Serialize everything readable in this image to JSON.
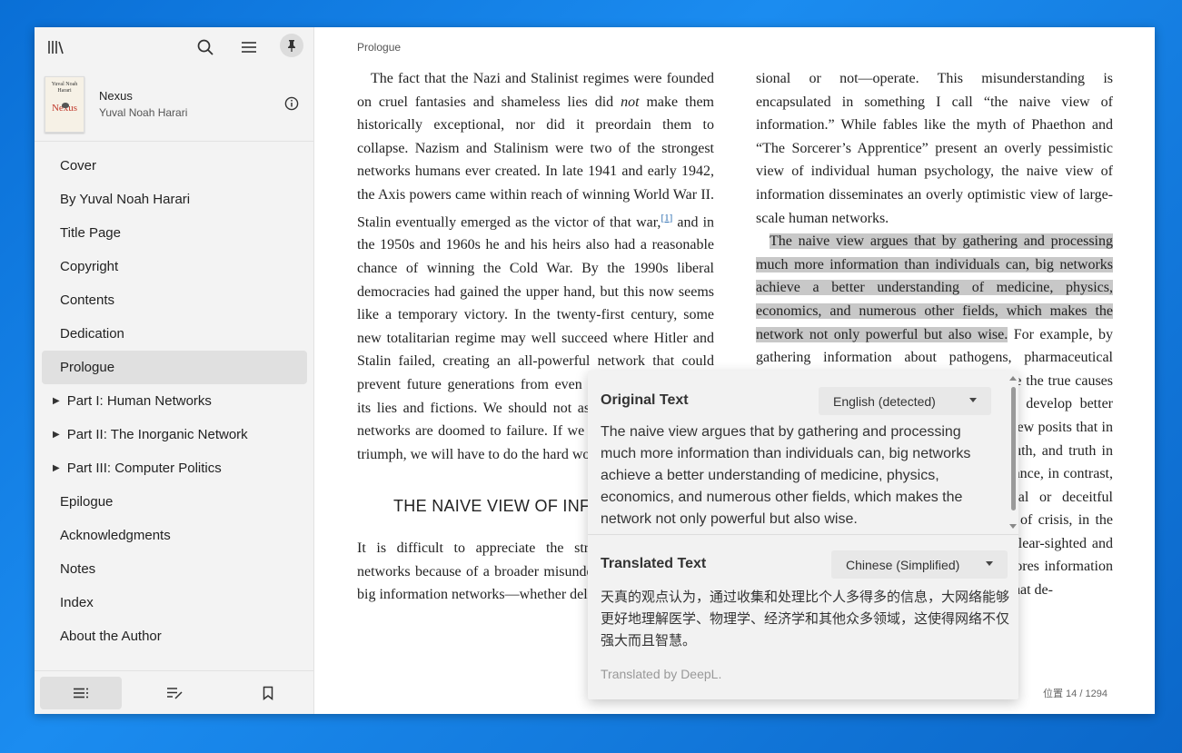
{
  "sidebar": {
    "book": {
      "cover_author": "Yuval Noah Harari",
      "cover_title": "Nexus",
      "title": "Nexus",
      "author": "Yuval Noah Harari"
    },
    "toc": [
      {
        "label": "Cover",
        "expandable": false,
        "active": false
      },
      {
        "label": "By Yuval Noah Harari",
        "expandable": false,
        "active": false
      },
      {
        "label": "Title Page",
        "expandable": false,
        "active": false
      },
      {
        "label": "Copyright",
        "expandable": false,
        "active": false
      },
      {
        "label": "Contents",
        "expandable": false,
        "active": false
      },
      {
        "label": "Dedication",
        "expandable": false,
        "active": false
      },
      {
        "label": "Prologue",
        "expandable": false,
        "active": true
      },
      {
        "label": "Part I: Human Networks",
        "expandable": true,
        "active": false
      },
      {
        "label": "Part II: The Inorganic Network",
        "expandable": true,
        "active": false
      },
      {
        "label": "Part III: Computer Politics",
        "expandable": true,
        "active": false
      },
      {
        "label": "Epilogue",
        "expandable": false,
        "active": false
      },
      {
        "label": "Acknowledgments",
        "expandable": false,
        "active": false
      },
      {
        "label": "Notes",
        "expandable": false,
        "active": false
      },
      {
        "label": "Index",
        "expandable": false,
        "active": false
      },
      {
        "label": "About the Author",
        "expandable": false,
        "active": false
      }
    ],
    "icons": [
      "library-icon",
      "search-icon",
      "menu-icon",
      "pin-icon",
      "info-icon",
      "toc-icon",
      "annotations-icon",
      "bookmark-icon"
    ]
  },
  "reader": {
    "chapter": "Prologue",
    "col1": {
      "p1_a": "The fact that the Nazi and Stalinist regimes were founded on cruel fantasies and shameless lies did ",
      "p1_em": "not",
      "p1_b": " make them historically exceptional, nor did it preordain them to collapse. Nazism and Stalinism were two of the strongest networks humans ever created. In late 1941 and early 1942, the Axis powers came within reach of winning World War II. Stalin eventually emerged as the victor of that war,",
      "p1_note": "[1]",
      "p1_c": " and in the 1950s and 1960s he and his heirs also had a reasonable chance of winning the Cold War. By the 1990s liberal democracies had gained the upper hand, but this now seems like a temporary victory. In the twenty-first century, some new totalitarian regime may well succeed where Hitler and Stalin failed, creating an all-powerful network that could prevent future generations from even attempting to expose its lies and fictions. We should not assume that delusional networks are doomed to failure. If we want to prevent their triumph, we will have to do the hard work ourselves.",
      "heading": "THE NAIVE VIEW OF INFORMATION",
      "p2": "It is difficult to appreciate the strength of delusional networks because of a broader misunderstanding about how big information networks—whether delu-"
    },
    "col2": {
      "p1": "sional or not—operate. This misunderstanding is encapsulated in something I call “the naive view of information.” While fables like the myth of Phaethon and “The Sorcerer’s Apprentice” present an overly pessimistic view of individual human psychology, the naive view of information disseminates an overly optimistic view of large-scale human networks.",
      "p2_hl": "The naive view argues that by gathering and processing much more information than individuals can, big networks achieve a better understanding of medicine, physics, economics, and numerous other fields, which makes the network not only powerful but also wise.",
      "p2_rest": " For example, by gathering information about pathogens, pharmaceutical companies and health services can determine the true causes of many diseases, which enables them to develop better medicines and make wiser decisions. This view posits that in sufficient quantities information leads to truth, and truth in turn leads to both power and wisdom. Ignorance, in contrast, seems to lead nowhere. While delusional or deceitful networks might occasionally arise in times of crisis, in the long term they are bound to lose to more clear-sighted and honest rivals. A health-care service that ignores information about pathogens, or a pharmaceutical giant that de-"
    },
    "location": "位置 14 / 1294"
  },
  "translate_popup": {
    "original_heading": "Original Text",
    "source_lang": "English (detected)",
    "original_text": "The naive view argues that by gathering and processing much more information than individuals can, big networks achieve a better understanding of medicine, physics, economics, and numerous other fields, which makes the network not only powerful but also wise.",
    "translated_heading": "Translated Text",
    "target_lang": "Chinese (Simplified)",
    "translated_text": "天真的观点认为，通过收集和处理比个人多得多的信息，大网络能够更好地理解医学、物理学、经济学和其他众多领域，这使得网络不仅强大而且智慧。",
    "credit": "Translated by DeepL."
  },
  "colors": {
    "desktop": "#1b8cf0",
    "sidebar_bg": "#f3f3f3",
    "active_item": "#e0e0e0",
    "highlight": "#c8c8c8",
    "popup_bg": "#f2f2f2"
  }
}
